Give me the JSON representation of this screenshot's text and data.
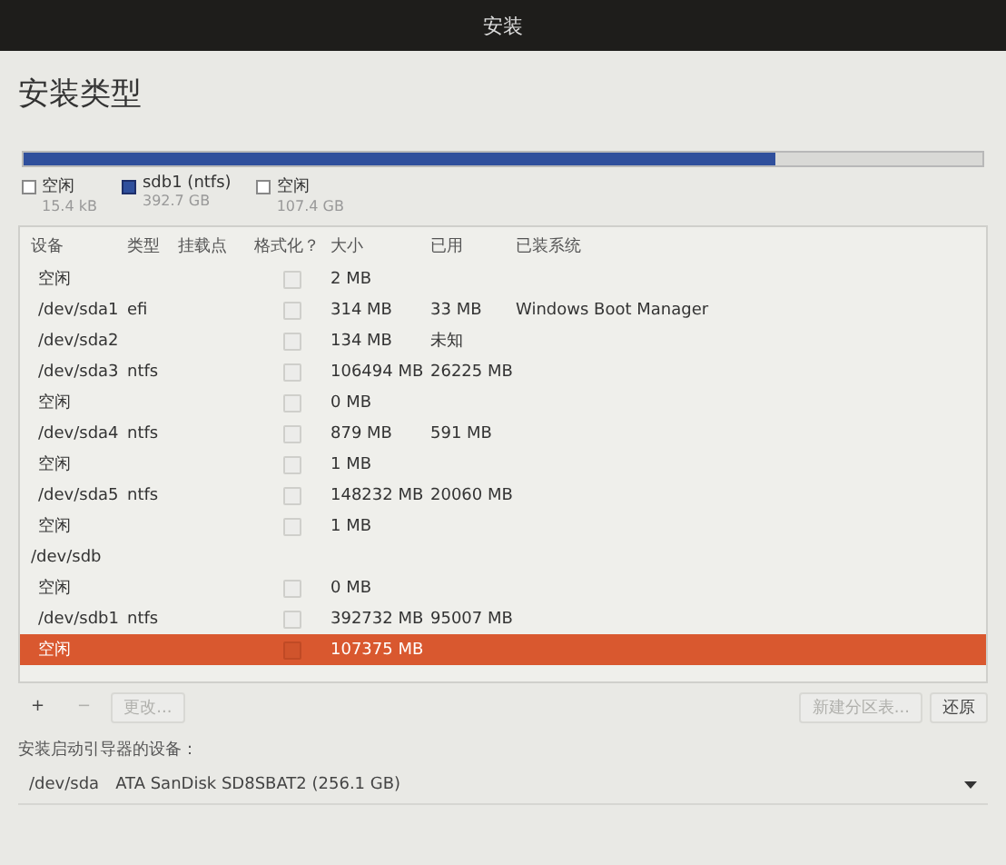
{
  "window": {
    "title": "安装"
  },
  "heading": "安装类型",
  "partition_bar": {
    "segments": [
      {
        "color": "#2f4f9c",
        "level": 0.785
      },
      {
        "color": "#d9d9d6",
        "level": 0.2149
      }
    ]
  },
  "legend": [
    {
      "name": "空闲",
      "size": "15.4 kB",
      "color": "#ffffff",
      "kind": "outline"
    },
    {
      "name": "sdb1 (ntfs)",
      "size": "392.7 GB",
      "color": "#2f4f9c",
      "kind": "filled"
    },
    {
      "name": "空闲",
      "size": "107.4 GB",
      "color": "#ffffff",
      "kind": "outline"
    }
  ],
  "table": {
    "columns": [
      "设备",
      "类型",
      "挂载点",
      "格式化？",
      "大小",
      "已用",
      "已装系统"
    ],
    "rows": [
      {
        "kind": "partition",
        "device": "空闲",
        "type": "",
        "mount": "",
        "format_checked": false,
        "size": "2 MB",
        "used": "",
        "system": "",
        "selected": false
      },
      {
        "kind": "partition",
        "device": "/dev/sda1",
        "type": "efi",
        "mount": "",
        "format_checked": false,
        "size": "314 MB",
        "used": "33 MB",
        "system": "Windows Boot Manager",
        "selected": false
      },
      {
        "kind": "partition",
        "device": "/dev/sda2",
        "type": "",
        "mount": "",
        "format_checked": false,
        "size": "134 MB",
        "used": "未知",
        "system": "",
        "selected": false
      },
      {
        "kind": "partition",
        "device": "/dev/sda3",
        "type": "ntfs",
        "mount": "",
        "format_checked": false,
        "size": "106494 MB",
        "used": "26225 MB",
        "system": "",
        "selected": false
      },
      {
        "kind": "partition",
        "device": "空闲",
        "type": "",
        "mount": "",
        "format_checked": false,
        "size": "0 MB",
        "used": "",
        "system": "",
        "selected": false
      },
      {
        "kind": "partition",
        "device": "/dev/sda4",
        "type": "ntfs",
        "mount": "",
        "format_checked": false,
        "size": "879 MB",
        "used": "591 MB",
        "system": "",
        "selected": false
      },
      {
        "kind": "partition",
        "device": "空闲",
        "type": "",
        "mount": "",
        "format_checked": false,
        "size": "1 MB",
        "used": "",
        "system": "",
        "selected": false
      },
      {
        "kind": "partition",
        "device": "/dev/sda5",
        "type": "ntfs",
        "mount": "",
        "format_checked": false,
        "size": "148232 MB",
        "used": "20060 MB",
        "system": "",
        "selected": false
      },
      {
        "kind": "partition",
        "device": "空闲",
        "type": "",
        "mount": "",
        "format_checked": false,
        "size": "1 MB",
        "used": "",
        "system": "",
        "selected": false
      },
      {
        "kind": "disk",
        "device": "/dev/sdb",
        "selected": false
      },
      {
        "kind": "partition",
        "device": "空闲",
        "type": "",
        "mount": "",
        "format_checked": false,
        "size": "0 MB",
        "used": "",
        "system": "",
        "selected": false
      },
      {
        "kind": "partition",
        "device": "/dev/sdb1",
        "type": "ntfs",
        "mount": "",
        "format_checked": false,
        "size": "392732 MB",
        "used": "95007 MB",
        "system": "",
        "selected": false
      },
      {
        "kind": "partition",
        "device": "空闲",
        "type": "",
        "mount": "",
        "format_checked": false,
        "size": "107375 MB",
        "used": "",
        "system": "",
        "selected": true
      }
    ]
  },
  "toolbar": {
    "add": "+",
    "remove": "−",
    "change": "更改...",
    "new_table": "新建分区表...",
    "revert": "还原"
  },
  "bootloader": {
    "label": "安装启动引导器的设备：",
    "device": "/dev/sda",
    "description": "ATA SanDisk SD8SBAT2 (256.1 GB)"
  }
}
